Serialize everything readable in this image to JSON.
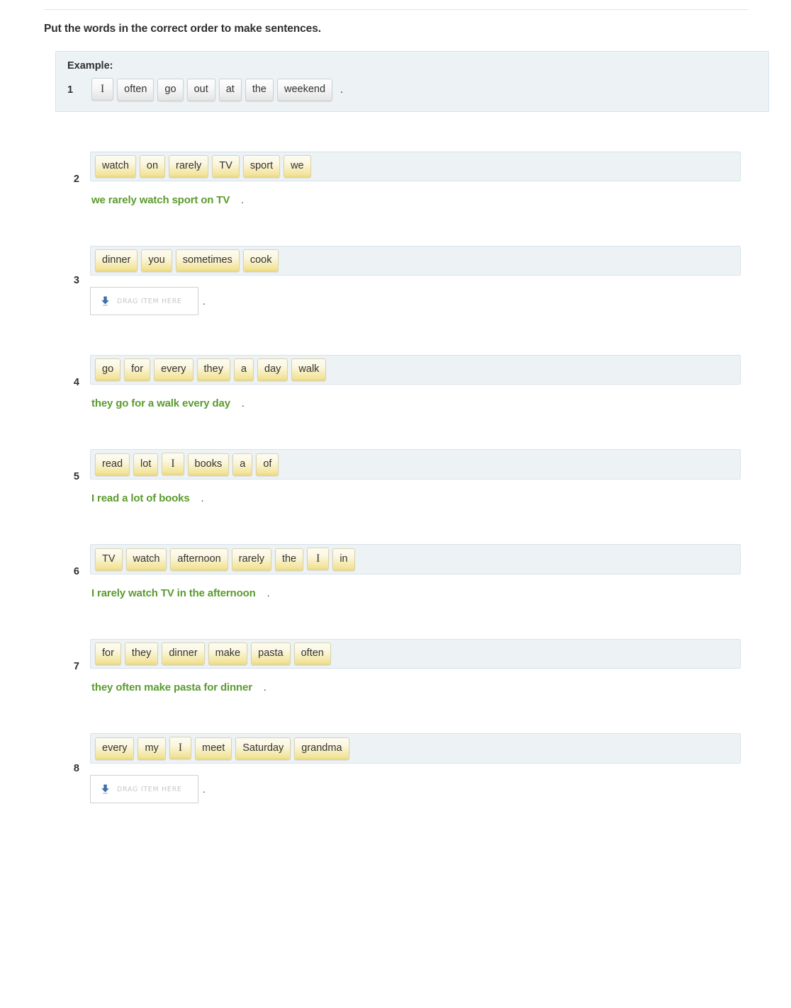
{
  "prompt": "Put the words in the correct order to make sentences.",
  "example": {
    "label": "Example:",
    "number": "1",
    "tiles": [
      "I",
      "often",
      "go",
      "out",
      "at",
      "the",
      "weekend"
    ],
    "trailing_dot": "."
  },
  "dropzone": {
    "label": "DRAG ITEM HERE",
    "icon": "download-arrow-icon",
    "trailing_dot": "."
  },
  "colors": {
    "answer_green": "#5b9b2f",
    "band_background": "#edf2f5",
    "band_border": "#d8e3ea",
    "tile_gold": "#f2e49a",
    "drop_icon_blue": "#3d6fa8"
  },
  "items": [
    {
      "number": "2",
      "tiles": [
        "watch",
        "on",
        "rarely",
        "TV",
        "sport",
        "we"
      ],
      "state": "answered",
      "answer": "we rarely watch sport on TV",
      "answer_dot": "."
    },
    {
      "number": "3",
      "tiles": [
        "dinner",
        "you",
        "sometimes",
        "cook"
      ],
      "state": "empty",
      "answer": "",
      "answer_dot": "."
    },
    {
      "number": "4",
      "tiles": [
        "go",
        "for",
        "every",
        "they",
        "a",
        "day",
        "walk"
      ],
      "state": "answered",
      "answer": "they go for a walk every day",
      "answer_dot": "."
    },
    {
      "number": "5",
      "tiles": [
        "read",
        "lot",
        "I",
        "books",
        "a",
        "of"
      ],
      "state": "answered",
      "answer": "I read a lot of books",
      "answer_dot": "."
    },
    {
      "number": "6",
      "tiles": [
        "TV",
        "watch",
        "afternoon",
        "rarely",
        "the",
        "I",
        "in"
      ],
      "state": "answered",
      "answer": "I rarely watch TV in the afternoon",
      "answer_dot": "."
    },
    {
      "number": "7",
      "tiles": [
        "for",
        "they",
        "dinner",
        "make",
        "pasta",
        "often"
      ],
      "state": "answered",
      "answer": "they often make pasta for dinner",
      "answer_dot": "."
    },
    {
      "number": "8",
      "tiles": [
        "every",
        "my",
        "I",
        "meet",
        "Saturday",
        "grandma"
      ],
      "state": "empty",
      "answer": "",
      "answer_dot": "."
    }
  ]
}
